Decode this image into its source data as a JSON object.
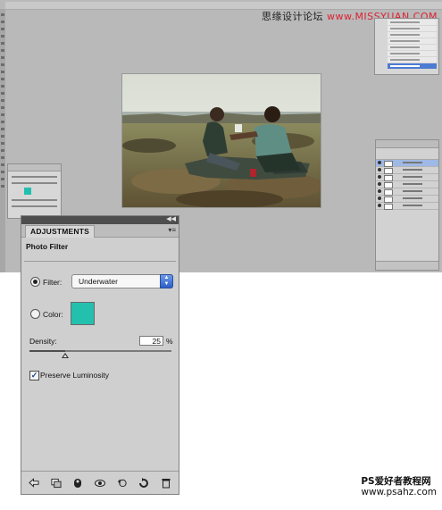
{
  "watermarks": {
    "top_prefix": "思缘设计论坛",
    "top_url": "www.MISSYUAN.COM",
    "bottom_line1": "PS爱好者教程网",
    "bottom_line2": "www.psahz.com"
  },
  "adjustments_panel": {
    "tab_label": "ADJUSTMENTS",
    "title": "Photo Filter",
    "filter_label": "Filter:",
    "filter_value": "Underwater",
    "filter_selected": true,
    "color_label": "Color:",
    "color_selected": false,
    "color_swatch": "#23c0ae",
    "density_label": "Density:",
    "density_value": "25",
    "density_unit": "%",
    "density_level": 0.25,
    "preserve_label": "Preserve Luminosity",
    "preserve_checked": true,
    "checkmark": "✓",
    "collapse_glyph": "◀◀",
    "menu_glyph": "▾≡",
    "toolbar_icons": [
      "back-arrow-icon",
      "expanded-view-icon",
      "clip-layer-icon",
      "visibility-eye-icon",
      "view-previous-icon",
      "reset-icon",
      "delete-icon"
    ]
  },
  "colors": {
    "workspace_bg": "#b9b9b9",
    "panel_bg": "#cfcfcf",
    "selected_blue": "#4d7bd2",
    "swatch": "#23c0ae"
  }
}
